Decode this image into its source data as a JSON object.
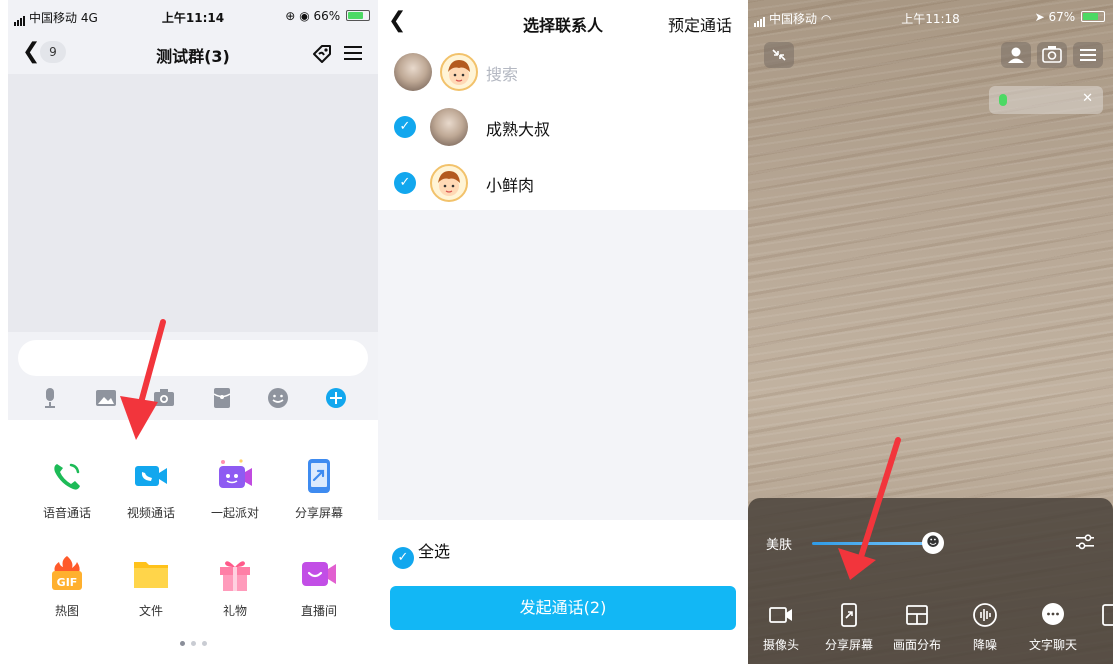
{
  "chat": {
    "status": {
      "carrier": "中国移动",
      "network": "4G",
      "time": "上午11:14",
      "battery": "66%"
    },
    "back_count": "9",
    "title": "测试群(3)",
    "input_placeholder": "",
    "features": [
      {
        "label": "语音通话",
        "icon": "phone-icon"
      },
      {
        "label": "视频通话",
        "icon": "video-call-icon"
      },
      {
        "label": "一起派对",
        "icon": "party-icon"
      },
      {
        "label": "分享屏幕",
        "icon": "share-screen-icon"
      },
      {
        "label": "热图",
        "icon": "gif-icon"
      },
      {
        "label": "文件",
        "icon": "folder-icon"
      },
      {
        "label": "礼物",
        "icon": "gift-icon"
      },
      {
        "label": "直播间",
        "icon": "live-room-icon"
      }
    ]
  },
  "picker": {
    "title": "选择联系人",
    "schedule": "预定通话",
    "search_placeholder": "搜索",
    "contacts": [
      {
        "name": "成熟大叔",
        "checked": true
      },
      {
        "name": "小鲜肉",
        "checked": true
      }
    ],
    "select_all": "全选",
    "start_button": "发起通话(2)"
  },
  "video": {
    "status": {
      "carrier": "中国移动",
      "time": "上午11:18",
      "battery": "67%"
    },
    "beauty_label": "美肤",
    "controls": [
      {
        "label": "摄像头",
        "icon": "camera-icon"
      },
      {
        "label": "分享屏幕",
        "icon": "share-screen-icon"
      },
      {
        "label": "画面分布",
        "icon": "layout-icon"
      },
      {
        "label": "降噪",
        "icon": "noise-reduction-icon"
      },
      {
        "label": "文字聊天",
        "icon": "text-chat-icon"
      }
    ]
  },
  "colors": {
    "accent": "#12b7f5",
    "check": "#12a7ee",
    "arrow": "#f2353c"
  }
}
